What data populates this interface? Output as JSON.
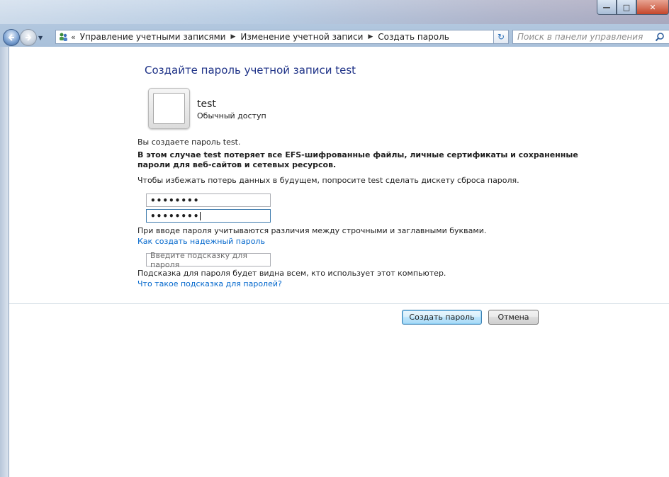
{
  "window": {
    "caption_buttons": {
      "minimize": "—",
      "maximize": "□",
      "close": "✕"
    }
  },
  "navbar": {
    "back_icon": "arrow-left-icon",
    "forward_icon": "arrow-right-icon",
    "address": {
      "overflow": "«",
      "segments": [
        "Управление учетными записями",
        "Изменение учетной записи",
        "Создать пароль"
      ]
    },
    "search": {
      "placeholder": "Поиск в панели управления"
    }
  },
  "page": {
    "title": "Создайте пароль учетной записи test",
    "user": {
      "name": "test",
      "type": "Обычный доступ"
    },
    "intro": "Вы создаете пароль test.",
    "warning_line1": "В этом случае test потеряет все EFS-шифрованные файлы, личные сертификаты и сохраненные",
    "warning_line2": "пароли для веб-сайтов и сетевых ресурсов.",
    "advice": "Чтобы избежать потерь данных в будущем, попросите test сделать дискету сброса пароля.",
    "password_value": "••••••••",
    "confirm_value": "••••••••",
    "case_note": "При вводе пароля учитываются различия между строчными и заглавными буквами.",
    "strong_link": "Как создать надежный пароль",
    "hint_placeholder": "Введите подсказку для пароля",
    "hint_note": "Подсказка для пароля будет видна всем, кто использует этот компьютер.",
    "hint_link": "Что такое подсказка для паролей?"
  },
  "buttons": {
    "create": "Создать пароль",
    "cancel": "Отмена"
  },
  "colors": {
    "title": "#1e3287",
    "link": "#0066cc",
    "default_button_border": "#3c7fb1"
  }
}
